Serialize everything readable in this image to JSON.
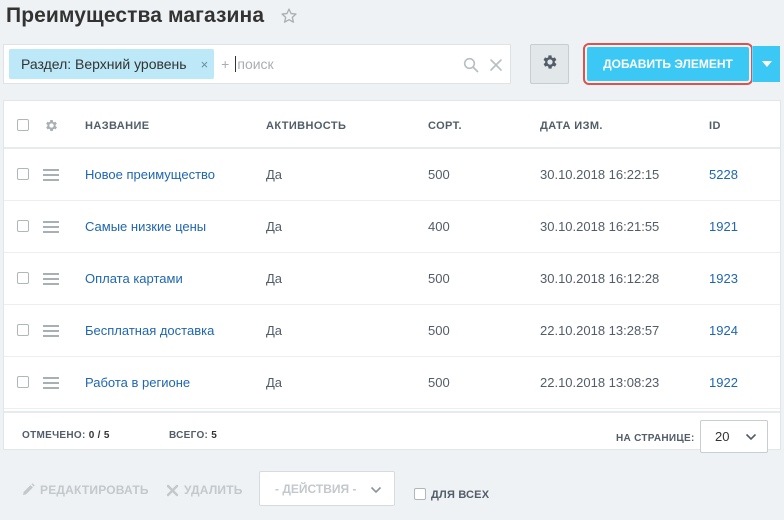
{
  "header": {
    "title": "Преимущества магазина",
    "star_icon": "star-outline-icon"
  },
  "filter": {
    "tag_label": "Раздел: Верхний уровень",
    "tag_close": "×",
    "plus": "+",
    "placeholder": "поиск",
    "value": ""
  },
  "toolbar": {
    "settings_icon": "gear-icon",
    "add_label": "ДОБАВИТЬ ЭЛЕМЕНТ",
    "accent_color": "#3bc8f5",
    "highlight_color": "#d9534f"
  },
  "grid": {
    "columns": [
      "НАЗВАНИЕ",
      "АКТИВНОСТЬ",
      "СОРТ.",
      "ДАТА ИЗМ.",
      "ID"
    ],
    "rows": [
      {
        "name": "Новое преимущество",
        "active": "Да",
        "sort": "500",
        "date": "30.10.2018 16:22:15",
        "id": "5228"
      },
      {
        "name": "Самые низкие цены",
        "active": "Да",
        "sort": "400",
        "date": "30.10.2018 16:21:55",
        "id": "1921"
      },
      {
        "name": "Оплата картами",
        "active": "Да",
        "sort": "500",
        "date": "30.10.2018 16:12:28",
        "id": "1923"
      },
      {
        "name": "Бесплатная доставка",
        "active": "Да",
        "sort": "500",
        "date": "22.10.2018 13:28:57",
        "id": "1924"
      },
      {
        "name": "Работа в регионе",
        "active": "Да",
        "sort": "500",
        "date": "22.10.2018 13:08:23",
        "id": "1922"
      }
    ]
  },
  "footer": {
    "checked_label": "ОТМЕЧЕНО:",
    "checked_value": "0 / 5",
    "total_label": "ВСЕГО:",
    "total_value": "5",
    "per_page_label": "НА СТРАНИЦЕ:",
    "per_page_value": "20"
  },
  "actions": {
    "edit_label": "РЕДАКТИРОВАТЬ",
    "delete_label": "УДАЛИТЬ",
    "actions_select": "- ДЕЙСТВИЯ -",
    "for_all_label": "ДЛЯ ВСЕХ"
  }
}
